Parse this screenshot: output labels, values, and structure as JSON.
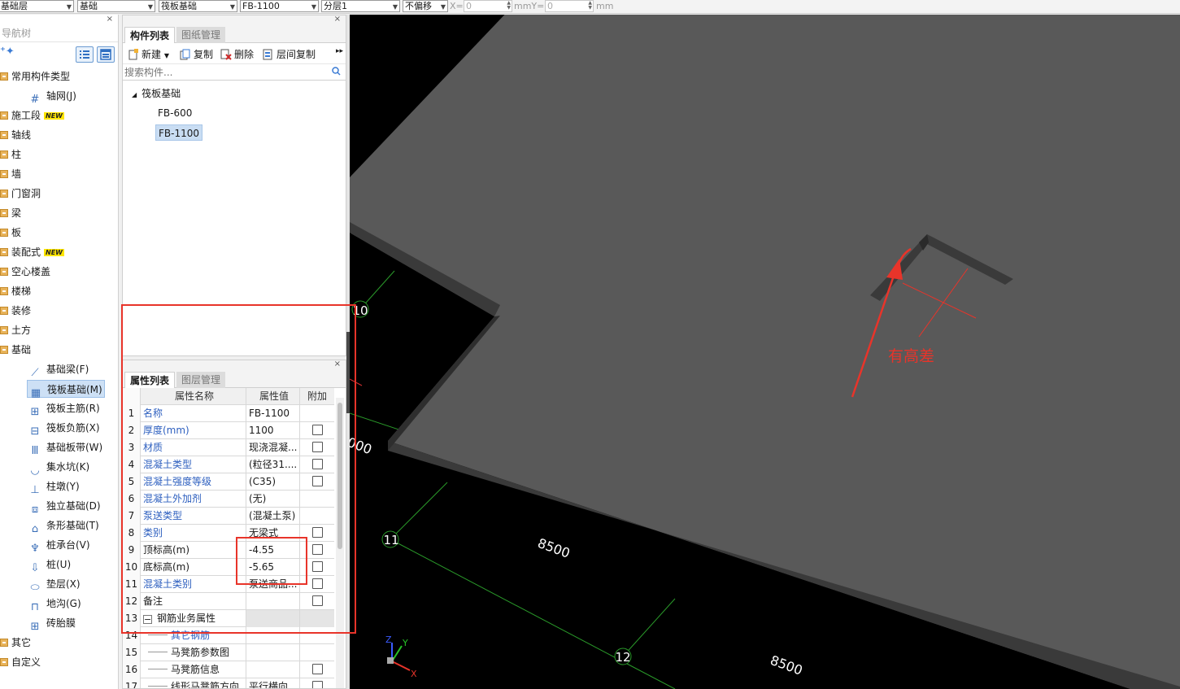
{
  "toolbar": {
    "floor": "基础层",
    "category": "基础",
    "type": "筏板基础",
    "component": "FB-1100",
    "layer": "分层1",
    "offset_mode": "不偏移",
    "x_label": "X=",
    "x_value": "0",
    "mmy_label": "mmY=",
    "y_value": "0",
    "mm_label": "mm"
  },
  "nav": {
    "title": "导航树",
    "items": [
      {
        "label": "常用构件类型",
        "kind": "folder"
      },
      {
        "label": "轴网(J)",
        "kind": "sub",
        "icon": "grid-icon"
      },
      {
        "label": "施工段",
        "kind": "folder",
        "badge": "NEW"
      },
      {
        "label": "轴线",
        "kind": "folder"
      },
      {
        "label": "柱",
        "kind": "folder"
      },
      {
        "label": "墙",
        "kind": "folder"
      },
      {
        "label": "门窗洞",
        "kind": "folder"
      },
      {
        "label": "梁",
        "kind": "folder"
      },
      {
        "label": "板",
        "kind": "folder"
      },
      {
        "label": "装配式",
        "kind": "folder",
        "badge": "NEW"
      },
      {
        "label": "空心楼盖",
        "kind": "folder"
      },
      {
        "label": "楼梯",
        "kind": "folder"
      },
      {
        "label": "装修",
        "kind": "folder"
      },
      {
        "label": "土方",
        "kind": "folder"
      },
      {
        "label": "基础",
        "kind": "folder"
      },
      {
        "label": "基础梁(F)",
        "kind": "sub",
        "icon": "beam-icon"
      },
      {
        "label": "筏板基础(M)",
        "kind": "sub",
        "icon": "raft-icon",
        "selected": true
      },
      {
        "label": "筏板主筋(R)",
        "kind": "sub",
        "icon": "rebar-icon"
      },
      {
        "label": "筏板负筋(X)",
        "kind": "sub",
        "icon": "neg-rebar-icon"
      },
      {
        "label": "基础板带(W)",
        "kind": "sub",
        "icon": "strip-icon"
      },
      {
        "label": "集水坑(K)",
        "kind": "sub",
        "icon": "pit-icon"
      },
      {
        "label": "柱墩(Y)",
        "kind": "sub",
        "icon": "pier-icon"
      },
      {
        "label": "独立基础(D)",
        "kind": "sub",
        "icon": "isolated-footing-icon"
      },
      {
        "label": "条形基础(T)",
        "kind": "sub",
        "icon": "strip-footing-icon"
      },
      {
        "label": "桩承台(V)",
        "kind": "sub",
        "icon": "pile-cap-icon"
      },
      {
        "label": "桩(U)",
        "kind": "sub",
        "icon": "pile-icon"
      },
      {
        "label": "垫层(X)",
        "kind": "sub",
        "icon": "cushion-icon"
      },
      {
        "label": "地沟(G)",
        "kind": "sub",
        "icon": "trench-icon"
      },
      {
        "label": "砖胎膜",
        "kind": "sub",
        "icon": "brick-mold-icon"
      },
      {
        "label": "其它",
        "kind": "folder"
      },
      {
        "label": "自定义",
        "kind": "folder"
      }
    ]
  },
  "component_panel": {
    "tabs": [
      {
        "label": "构件列表",
        "active": true
      },
      {
        "label": "图纸管理",
        "active": false
      }
    ],
    "tools": {
      "new": "新建",
      "copy": "复制",
      "delete": "删除",
      "floor_copy": "层间复制"
    },
    "search_placeholder": "搜索构件...",
    "tree_root": "筏板基础",
    "tree_items": [
      {
        "label": "FB-600"
      },
      {
        "label": "FB-1100",
        "selected": true
      }
    ]
  },
  "property_panel": {
    "tabs": [
      {
        "label": "属性列表",
        "active": true
      },
      {
        "label": "图层管理",
        "active": false
      }
    ],
    "headers": {
      "name": "属性名称",
      "value": "属性值",
      "extra": "附加"
    },
    "rows": [
      {
        "no": "1",
        "name": "名称",
        "value": "FB-1100",
        "blue": true,
        "check": false
      },
      {
        "no": "2",
        "name": "厚度(mm)",
        "value": "1100",
        "blue": true,
        "check": true
      },
      {
        "no": "3",
        "name": "材质",
        "value": "现浇混凝...",
        "blue": true,
        "check": true
      },
      {
        "no": "4",
        "name": "混凝土类型",
        "value": "(粒径31....",
        "blue": true,
        "check": true
      },
      {
        "no": "5",
        "name": "混凝土强度等级",
        "value": "(C35)",
        "blue": true,
        "check": true
      },
      {
        "no": "6",
        "name": "混凝土外加剂",
        "value": "(无)",
        "blue": true,
        "check": false
      },
      {
        "no": "7",
        "name": "泵送类型",
        "value": "(混凝土泵)",
        "blue": true,
        "check": false
      },
      {
        "no": "8",
        "name": "类别",
        "value": "无梁式",
        "blue": true,
        "check": true
      },
      {
        "no": "9",
        "name": "顶标高(m)",
        "value": "-4.55",
        "blue": false,
        "check": true
      },
      {
        "no": "10",
        "name": "底标高(m)",
        "value": "-5.65",
        "blue": false,
        "check": true
      },
      {
        "no": "11",
        "name": "混凝土类别",
        "value": "泵送商品...",
        "blue": true,
        "check": true
      },
      {
        "no": "12",
        "name": "备注",
        "value": "",
        "blue": false,
        "check": true
      },
      {
        "no": "13",
        "name": "钢筋业务属性",
        "value": "",
        "blue": false,
        "check": false,
        "group": true
      },
      {
        "no": "14",
        "name": "其它钢筋",
        "value": "",
        "blue": true,
        "check": false,
        "indent": true
      },
      {
        "no": "15",
        "name": "马凳筋参数图",
        "value": "",
        "blue": false,
        "check": false,
        "indent": true
      },
      {
        "no": "16",
        "name": "马凳筋信息",
        "value": "",
        "blue": false,
        "check": true,
        "indent": true
      },
      {
        "no": "17",
        "name": "线形马凳筋方向",
        "value": "平行横向...",
        "blue": false,
        "check": true,
        "indent": true
      }
    ]
  },
  "viewport": {
    "axis_labels": [
      "10",
      "11",
      "12"
    ],
    "dimension_labels": [
      "8500",
      "8500",
      "000"
    ],
    "annotation": "有高差",
    "axis_x": "X",
    "axis_y": "Y",
    "axis_z": "Z",
    "colors": {
      "background": "#000000",
      "slab": "#595959",
      "slab_edge": "#3a3a3a",
      "grid_line": "#2a9a2a",
      "annotation": "#e8342a"
    }
  }
}
